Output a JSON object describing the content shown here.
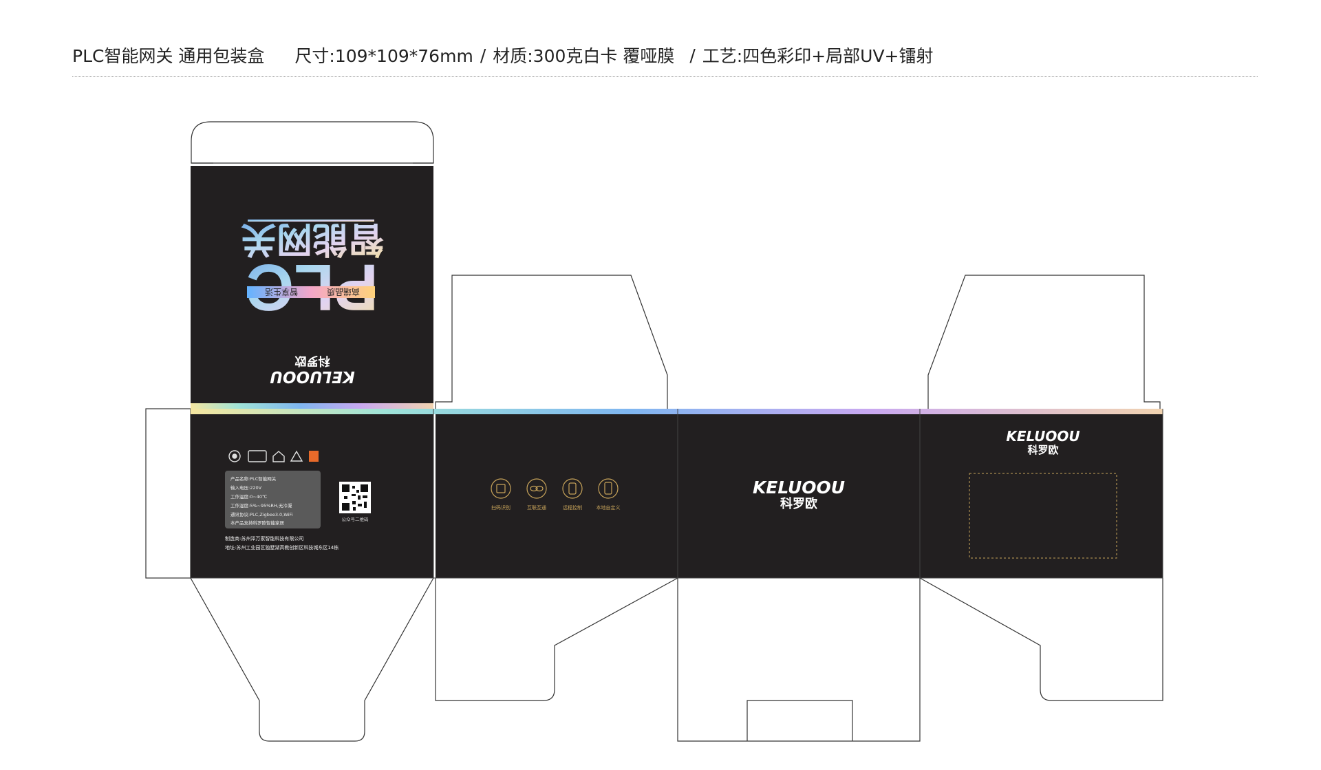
{
  "header": {
    "title": "PLC智能网关 通用包装盒",
    "size": "尺寸:109*109*76mm",
    "sep1": "/",
    "material": "材质:300克白卡 覆哑膜",
    "sep2": "/",
    "process": "工艺:四色彩印+局部UV+镭射"
  },
  "top_panel": {
    "product_name": "智能网关",
    "product_code": "PLC",
    "slogan_left": "高端品质",
    "slogan_right": "智享生活",
    "brand_cn": "科罗欧",
    "brand_en": "KELUOOU"
  },
  "back_panel": {
    "spec_lines": [
      "产品名称:PLC智能网关",
      "输入电压:220V",
      "工作温度:0~40℃",
      "工作湿度:5%~95%RH,无冷凝",
      "通讯协议:PLC,Zigbee3.0,WiFi",
      "本产品支持科罗欧智能家居"
    ],
    "qr_caption": "公众号二维码",
    "manufacturer": "制造商:苏州泽万家智能科技有限公司",
    "address": "地址:苏州工业园区独墅湖高教创新区科技城东区14栋"
  },
  "feature_panel": {
    "features": [
      {
        "icon": "scan-icon",
        "label": "扫码识别"
      },
      {
        "icon": "link-icon",
        "label": "互联互通"
      },
      {
        "icon": "remote-icon",
        "label": "远程控制"
      },
      {
        "icon": "phone-icon",
        "label": "本地自定义"
      }
    ]
  },
  "front_panel": {
    "brand_en": "KELUOOU",
    "brand_cn": "科罗欧"
  },
  "side_panel": {
    "brand_en": "KELUOOU",
    "brand_cn": "科罗欧"
  },
  "colors": {
    "panel": "#221f20",
    "line": "#333333",
    "gold": "#c8a45a",
    "spec_box": "#5a5a5a"
  }
}
